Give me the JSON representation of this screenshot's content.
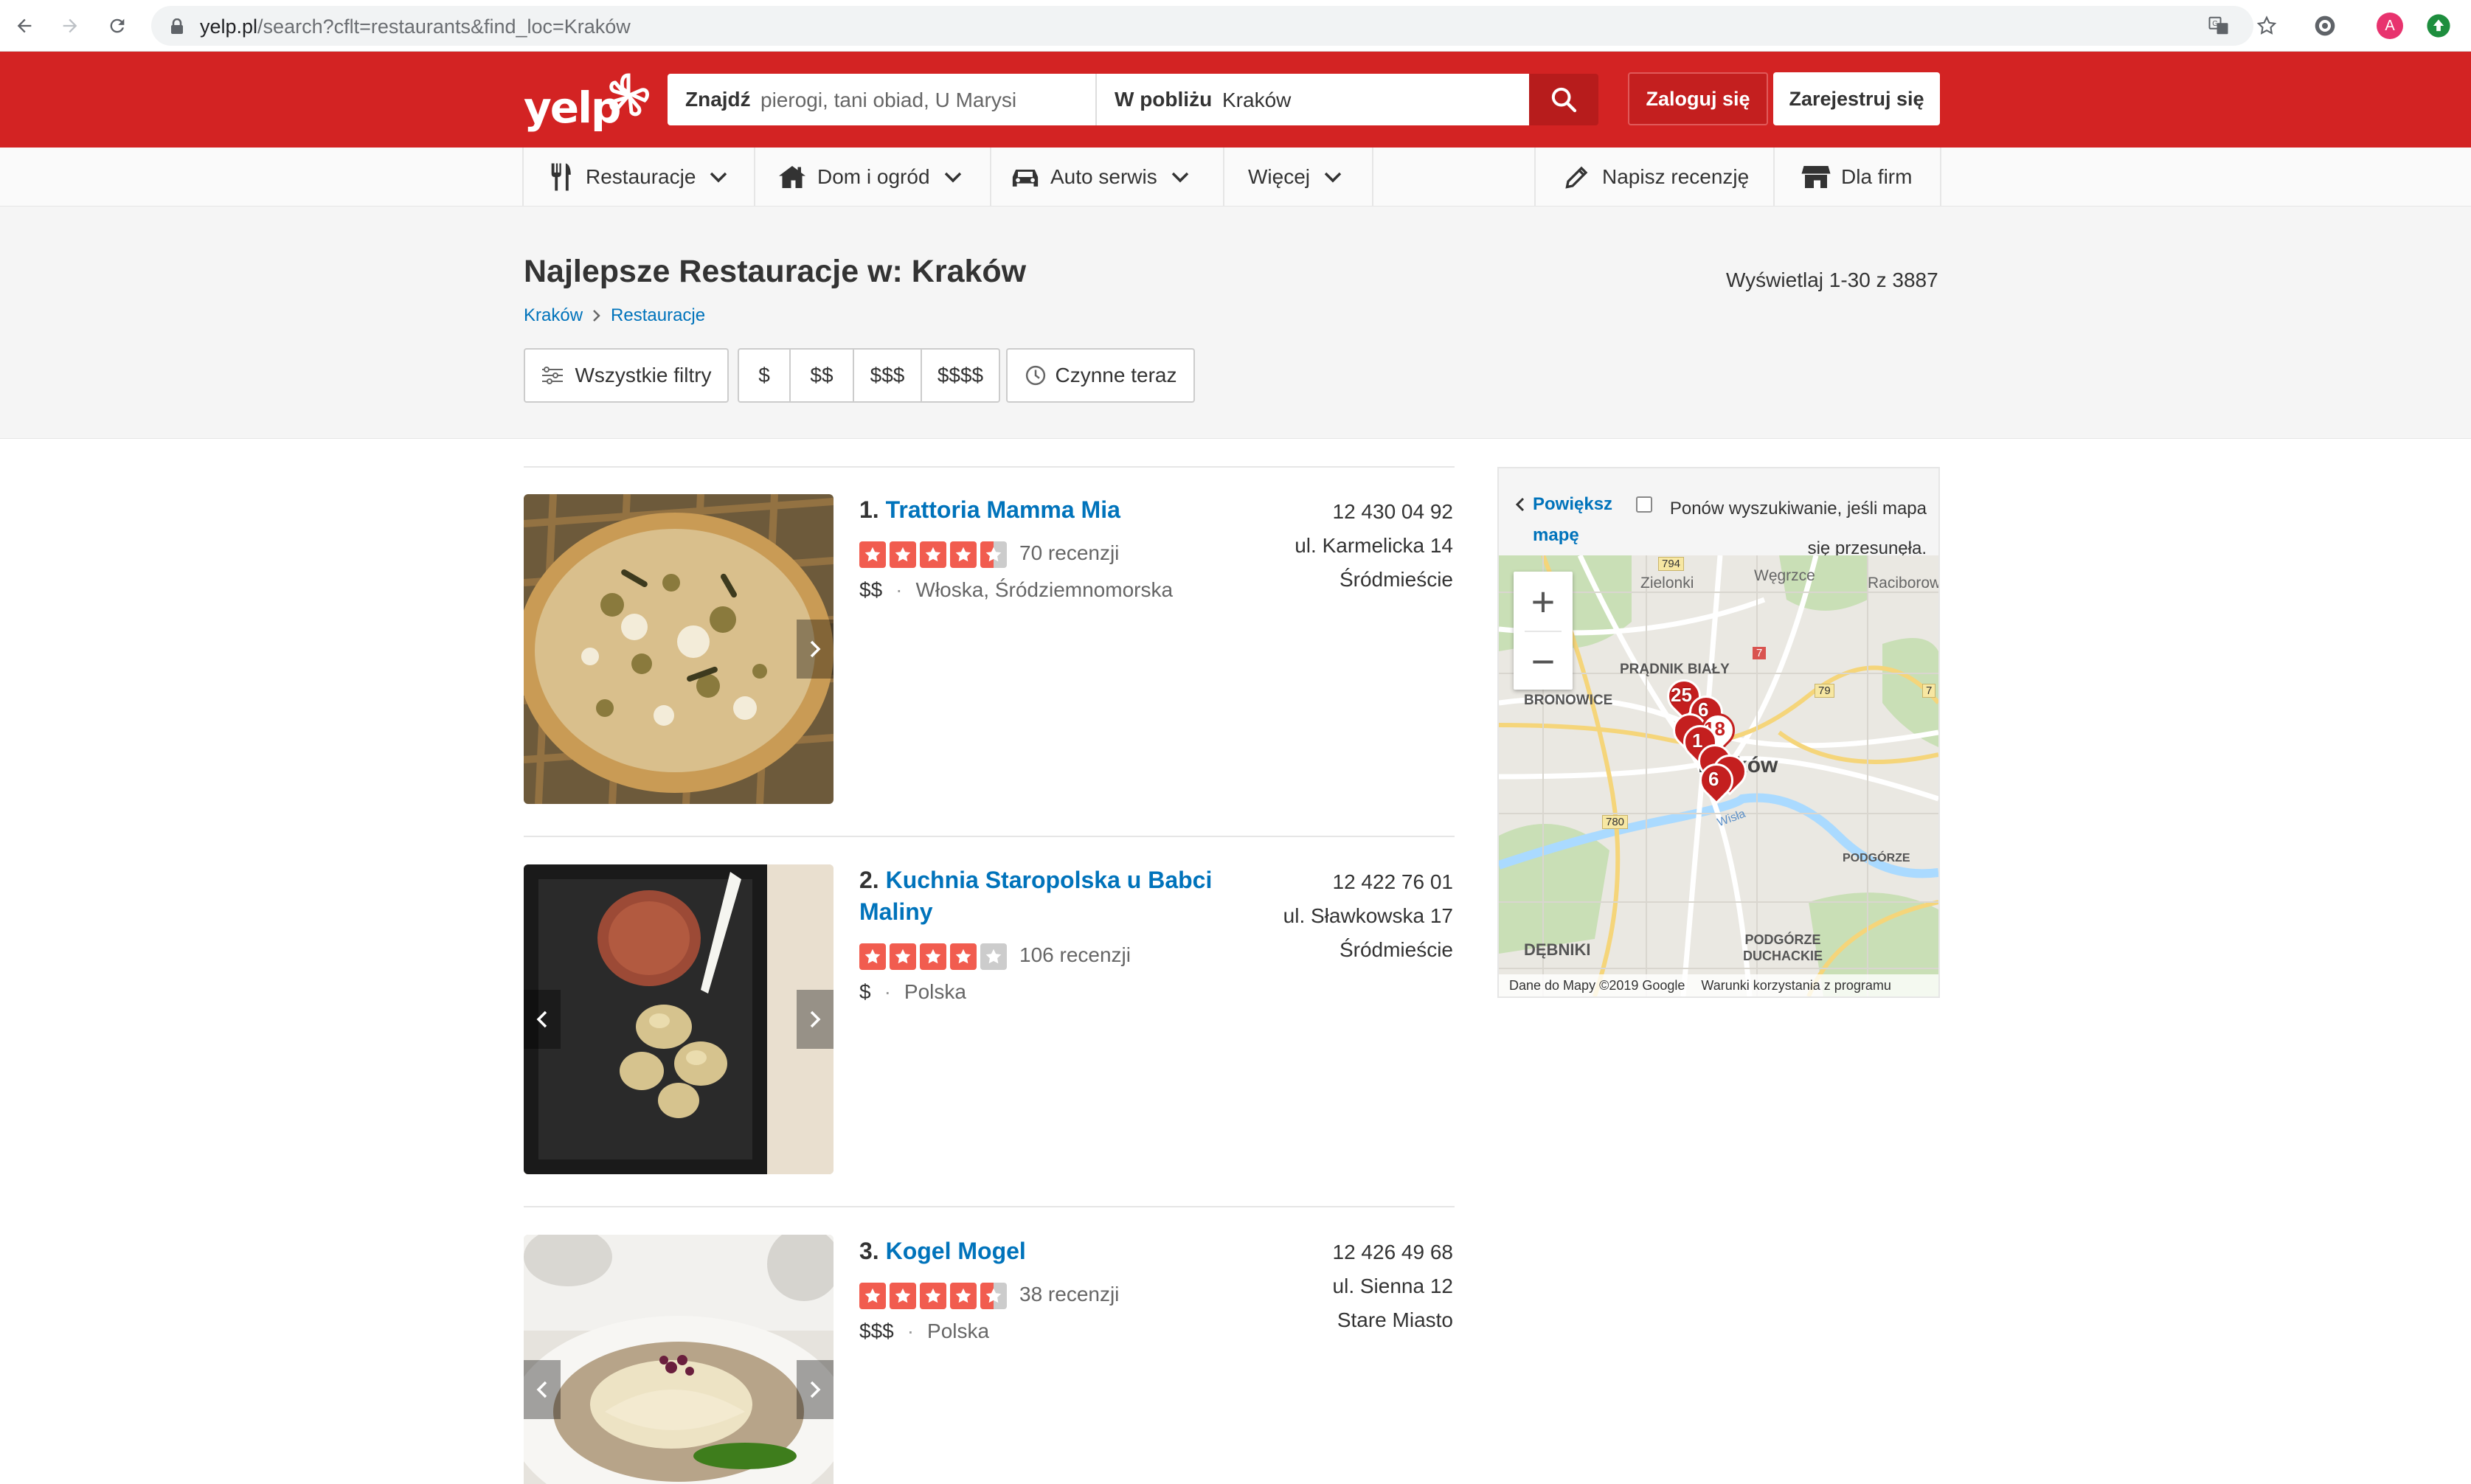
{
  "browser": {
    "url_host": "yelp.pl",
    "url_path": "/search?cflt=restaurants&find_loc=Kraków",
    "profile_initial": "A"
  },
  "header": {
    "logo": "yelp",
    "find_label": "Znajdź",
    "find_placeholder": "pierogi, tani obiad, U Marysi",
    "near_label": "W pobliżu",
    "near_value": "Kraków",
    "login": "Zaloguj się",
    "signup": "Zarejestruj się"
  },
  "categories": {
    "restaurants": "Restauracje",
    "home": "Dom i ogród",
    "auto": "Auto serwis",
    "more": "Więcej",
    "write_review": "Napisz recenzję",
    "business": "Dla firm"
  },
  "page": {
    "title": "Najlepsze Restauracje w: Kraków",
    "showing": "Wyświetlaj 1-30 z 3887",
    "breadcrumb": [
      "Kraków",
      "Restauracje"
    ]
  },
  "filters": {
    "all_filters": "Wszystkie filtry",
    "prices": [
      "$",
      "$$",
      "$$$",
      "$$$$"
    ],
    "open_now": "Czynne teraz"
  },
  "results": [
    {
      "rank": "1.",
      "name": "Trattoria Mamma Mia",
      "rating": 4.5,
      "reviews": "70 recenzji",
      "price": "$$",
      "categories": "Włoska, Śródziemnomorska",
      "phone": "12 430 04 92",
      "address": "ul. Karmelicka 14",
      "district": "Śródmieście"
    },
    {
      "rank": "2.",
      "name": "Kuchnia Staropolska u Babci Maliny",
      "rating": 4,
      "reviews": "106 recenzji",
      "price": "$",
      "categories": "Polska",
      "phone": "12 422 76 01",
      "address": "ul. Sławkowska 17",
      "district": "Śródmieście"
    },
    {
      "rank": "3.",
      "name": "Kogel Mogel",
      "rating": 4.5,
      "reviews": "38 recenzji",
      "price": "$$$",
      "categories": "Polska",
      "phone": "12 426 49 68",
      "address": "ul. Sienna 12",
      "district": "Stare Miasto"
    }
  ],
  "map": {
    "expand": "Powiększ mapę",
    "redo": "Ponów wyszukiwanie, jeśli mapa się przesunęła.",
    "zoom_in": "+",
    "zoom_out": "−",
    "labels": {
      "zielonki": "Zielonki",
      "wegrzce": "Węgrzce",
      "raciborow": "Raciborow",
      "pradnik": "PRĄDNIK BIAŁY",
      "bronowice": "BRONOWICE",
      "krakow": "Kraków",
      "podgorze": "PODGÓRZE",
      "debniki": "DĘBNIKI",
      "podgorze_duchackie": "PODGÓRZE DUCHACKIE",
      "wisla": "Wisła",
      "r794": "794",
      "r7": "7",
      "r79": "79",
      "r780": "780",
      "r7b": "7"
    },
    "pins": [
      "25",
      "6",
      "18",
      "1",
      "6"
    ],
    "attribution": "Dane do Mapy ©2019 Google",
    "terms": "Warunki korzystania z programu"
  },
  "colors": {
    "brand_red": "#d32323",
    "link_blue": "#0073bb",
    "star_red": "#f15c4f"
  }
}
